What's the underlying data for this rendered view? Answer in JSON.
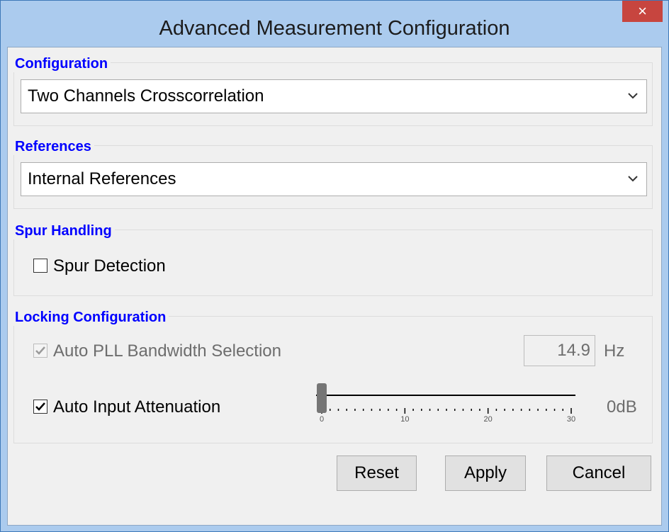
{
  "window": {
    "title": "Advanced Measurement Configuration",
    "close_label": "×"
  },
  "configuration": {
    "label": "Configuration",
    "selected": "Two Channels Crosscorrelation"
  },
  "references": {
    "label": "References",
    "selected": "Internal References"
  },
  "spur_handling": {
    "label": "Spur Handling",
    "spur_detection": {
      "label": "Spur Detection",
      "checked": false
    }
  },
  "locking": {
    "label": "Locking Configuration",
    "auto_pll": {
      "label": "Auto PLL Bandwidth Selection",
      "checked": true,
      "disabled": true
    },
    "bandwidth": {
      "value": "14.9",
      "unit": "Hz"
    },
    "auto_attenuation": {
      "label": "Auto Input Attenuation",
      "checked": true
    },
    "attenuation_slider": {
      "min": 0,
      "max": 30,
      "value": 0,
      "ticks": [
        "0",
        "10",
        "20",
        "30"
      ],
      "readout": "0dB"
    }
  },
  "buttons": {
    "reset": "Reset",
    "apply": "Apply",
    "cancel": "Cancel"
  },
  "colors": {
    "group_label": "#0000ff",
    "title_bar": "#abcbee",
    "close": "#c7453f"
  }
}
